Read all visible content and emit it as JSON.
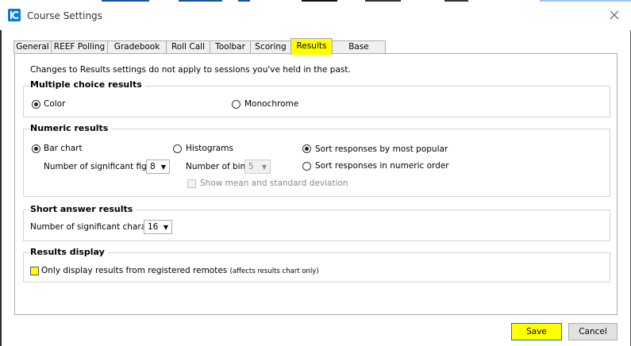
{
  "window": {
    "title": "Course Settings",
    "accent": "#0078d7"
  },
  "tabs": [
    {
      "label": "General"
    },
    {
      "label": "REEF Polling"
    },
    {
      "label": "Gradebook"
    },
    {
      "label": "Roll Call"
    },
    {
      "label": "Toolbar"
    },
    {
      "label": "Scoring"
    },
    {
      "label": "Results",
      "active": true
    },
    {
      "label": "Base Display"
    }
  ],
  "notice": "Changes to Results settings do not apply to sessions you've held in the past.",
  "multiple_choice": {
    "title": "Multiple choice results",
    "color_label": "Color",
    "monochrome_label": "Monochrome",
    "selected": "Color"
  },
  "numeric": {
    "title": "Numeric results",
    "bar_chart_label": "Bar chart",
    "histograms_label": "Histograms",
    "sig_figs_label": "Number of significant figures:",
    "sig_figs_value": "8",
    "bins_label": "Number of bins:",
    "bins_value": "5",
    "mean_sd_label": "Show mean and standard deviation",
    "sort_popular_label": "Sort responses by most popular",
    "sort_numeric_label": "Sort responses in numeric order",
    "selected_chart": "Bar chart",
    "selected_sort": "Sort responses by most popular"
  },
  "short_answer": {
    "title": "Short answer results",
    "chars_label": "Number of significant characters:",
    "chars_value": "16"
  },
  "results_display": {
    "title": "Results display",
    "registered_label": "Only display results from registered remotes",
    "registered_note": "(affects results chart only)",
    "checked": false
  },
  "footer": {
    "save_label": "Save",
    "cancel_label": "Cancel"
  },
  "highlight_color": "#ffff00"
}
